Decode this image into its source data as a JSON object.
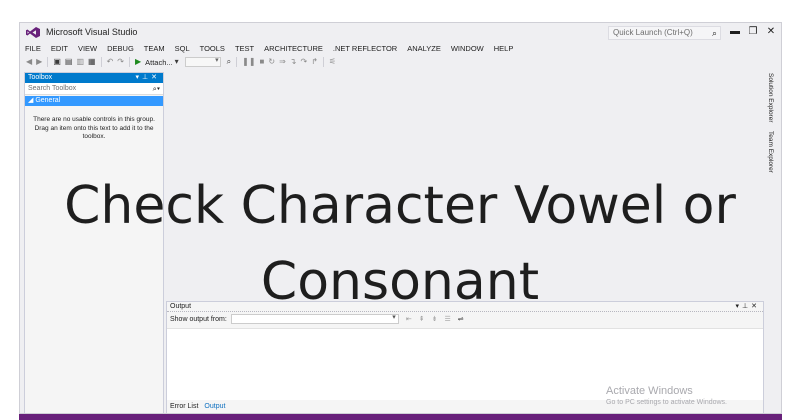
{
  "window": {
    "title": "Microsoft Visual Studio",
    "quick_launch_placeholder": "Quick Launch (Ctrl+Q)"
  },
  "menu": [
    "FILE",
    "EDIT",
    "VIEW",
    "DEBUG",
    "TEAM",
    "SQL",
    "TOOLS",
    "TEST",
    "ARCHITECTURE",
    ".NET REFLECTOR",
    "ANALYZE",
    "WINDOW",
    "HELP"
  ],
  "toolbar": {
    "attach_label": "Attach...",
    "attach_icon": "play-icon"
  },
  "toolbox": {
    "title": "Toolbox",
    "search_placeholder": "Search Toolbox",
    "group_label": "◢ General",
    "empty_message": "There are no usable controls in this group. Drag an item onto this text to add it to the toolbox."
  },
  "side_tabs": [
    "Solution Explorer",
    "Team Explorer"
  ],
  "output": {
    "title": "Output",
    "show_output_label": "Show output from:",
    "tabs": [
      "Error List",
      "Output"
    ],
    "active_tab": "Output"
  },
  "watermark": {
    "title": "Activate Windows",
    "subtitle": "Go to PC settings to activate Windows."
  },
  "overlay": {
    "line1": "Check Character Vowel or",
    "line2": "Consonant"
  },
  "colors": {
    "accent": "#007acc",
    "selection": "#3399ff",
    "statusbar": "#68217a",
    "chrome": "#efeff2"
  }
}
